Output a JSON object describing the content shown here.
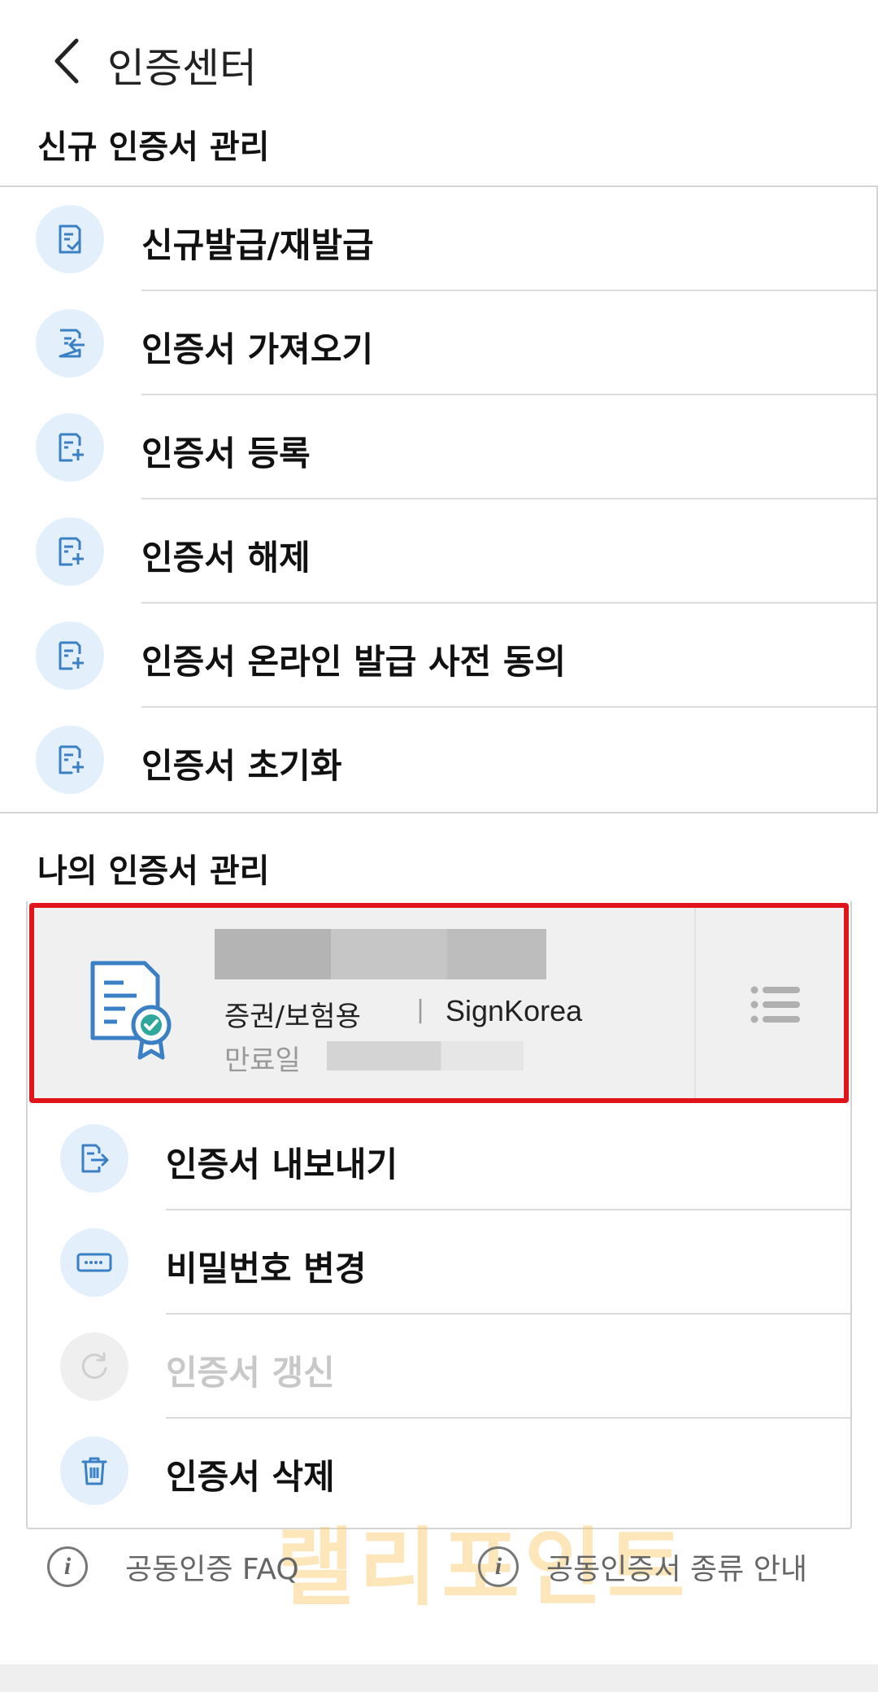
{
  "header": {
    "title": "인증센터"
  },
  "new_cert_section": {
    "title": "신규 인증서 관리",
    "items": [
      {
        "label": "신규발급/재발급",
        "icon": "doc-check-icon"
      },
      {
        "label": "인증서 가져오기",
        "icon": "doc-import-icon"
      },
      {
        "label": "인증서 등록",
        "icon": "doc-plus-icon"
      },
      {
        "label": "인증서 해제",
        "icon": "doc-plus-icon"
      },
      {
        "label": "인증서 온라인 발급 사전 동의",
        "icon": "doc-plus-icon"
      },
      {
        "label": "인증서 초기화",
        "icon": "doc-plus-icon"
      }
    ]
  },
  "my_cert_section": {
    "title": "나의 인증서 관리",
    "card": {
      "usage": "증권/보험용",
      "divider": "|",
      "issuer": "SignKorea",
      "expiry_label": "만료일"
    },
    "actions": [
      {
        "label": "인증서 내보내기",
        "icon": "doc-export-icon",
        "enabled": true
      },
      {
        "label": "비밀번호 변경",
        "icon": "password-icon",
        "enabled": true
      },
      {
        "label": "인증서 갱신",
        "icon": "refresh-icon",
        "enabled": false
      },
      {
        "label": "인증서 삭제",
        "icon": "trash-icon",
        "enabled": true
      }
    ]
  },
  "footer": {
    "faq_label": "공동인증 FAQ",
    "types_label": "공동인증서 종류 안내",
    "info_glyph": "i"
  },
  "watermark": {
    "text": "랠리포인트"
  },
  "colors": {
    "accent_blue": "#3b7fc4",
    "icon_bg": "#e3f0fb",
    "highlight_red": "#e0141b"
  }
}
